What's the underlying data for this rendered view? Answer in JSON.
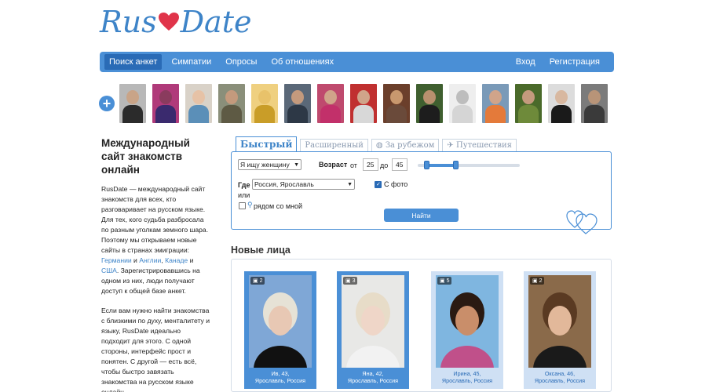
{
  "logo": {
    "left": "Rus",
    "right": "Date"
  },
  "nav": {
    "items": [
      "Поиск анкет",
      "Симпатии",
      "Опросы",
      "Об отношениях"
    ],
    "right_items": [
      "Вход",
      "Регистрация"
    ]
  },
  "avatars": {
    "add_label": "+",
    "people": [
      {
        "head": "#c9a488",
        "body": "#2b2b2b",
        "bg": "#b8b8b8"
      },
      {
        "head": "#8a3b5e",
        "body": "#3a2a6e",
        "bg": "#b03a7a"
      },
      {
        "head": "#e6c2a6",
        "body": "#5b8fb8",
        "bg": "#d9d2c8"
      },
      {
        "head": "#c49a7d",
        "body": "#5e5a44",
        "bg": "#8a8f7a"
      },
      {
        "head": "#e8c26a",
        "body": "#c99d28",
        "bg": "#efd080"
      },
      {
        "head": "#c49a7d",
        "body": "#2d3846",
        "bg": "#5a6878"
      },
      {
        "head": "#d0a48a",
        "body": "#c2306a",
        "bg": "#bf4a6e"
      },
      {
        "head": "#d0a48a",
        "body": "#d8d8d8",
        "bg": "#c03030"
      },
      {
        "head": "#c8986e",
        "body": "#6a4a3a",
        "bg": "#6b3f2b"
      },
      {
        "head": "#b8906e",
        "body": "#1d1d1d",
        "bg": "#3f5f2f"
      },
      {
        "head": "#bdbdbd",
        "body": "#d5d5d5",
        "bg": "#eeeeee"
      },
      {
        "head": "#d0a48a",
        "body": "#e47a3a",
        "bg": "#7a9ab8"
      },
      {
        "head": "#c49a7d",
        "body": "#6e8a3a",
        "bg": "#4a6a2a"
      },
      {
        "head": "#d8b8a0",
        "body": "#1a1a1a",
        "bg": "#dcdcdc"
      },
      {
        "head": "#b89478",
        "body": "#3a3a3a",
        "bg": "#7b7b7b"
      }
    ]
  },
  "left": {
    "title": "Международный сайт знакомств онлайн",
    "p1_a": "RusDate — международный сайт знакомств для всех, кто разговаривает на русском языке. Для тех, кого судьба разбросала по разным уголкам земного шара. Поэтому мы открываем новые сайты в странах эмиграции: ",
    "link_germany": "Германии",
    "and1": " и ",
    "link_england": "Англии",
    "comma": ", ",
    "link_canada": "Канаде",
    "and2": " и ",
    "link_usa": "США",
    "p1_b": ". Зарегистрировавшись на одном из них, люди получают доступ к общей базе анкет.",
    "p2": "Если вам нужно найти знакомства с близкими по духу, менталитету и языку, RusDate идеально подходит для этого. С одной стороны, интерфейс прост и понятен. С другой — есть всё, чтобы быстро завязать знакомства на русском языке онлайн."
  },
  "search": {
    "tabs": [
      "Быстрый",
      "Расширенный",
      "За рубежом",
      "Путешествия"
    ],
    "seek": "Я ищу женщину",
    "age_label": "Возраст",
    "from": "от",
    "age_from": "25",
    "to": "до",
    "age_to": "45",
    "where_label": "Где",
    "location": "Россия, Ярославль",
    "or": "или",
    "nearby": "рядом со мной",
    "with_photo": "С фото",
    "with_photo_checked": true,
    "find_button": "Найти"
  },
  "new_faces": {
    "title": "Новые лица",
    "cards": [
      {
        "photos": "2",
        "name": "Ив, 43,",
        "city": "Ярославль, Россия",
        "hl": true,
        "bg": "#7fa7d6",
        "hair": "#e6e2d6",
        "face": "#e8c8b4",
        "cloth": "#111111"
      },
      {
        "photos": "3",
        "name": "Яна, 42,",
        "city": "Ярославль, Россия",
        "hl": true,
        "bg": "#e8e8e6",
        "hair": "#e7dcc8",
        "face": "#efd6c8",
        "cloth": "#f2f2f2"
      },
      {
        "photos": "5",
        "name": "Ирина, 45,",
        "city": "Ярославль, Россия",
        "hl": false,
        "bg": "#7fb6e0",
        "hair": "#2a1a12",
        "face": "#c98e6a",
        "cloth": "#c0508a"
      },
      {
        "photos": "2",
        "name": "Оксана, 46,",
        "city": "Ярославль, Россия",
        "hl": false,
        "bg": "#8a6a4a",
        "hair": "#5a3a22",
        "face": "#e2b89a",
        "cloth": "#1a1a1a"
      }
    ]
  }
}
